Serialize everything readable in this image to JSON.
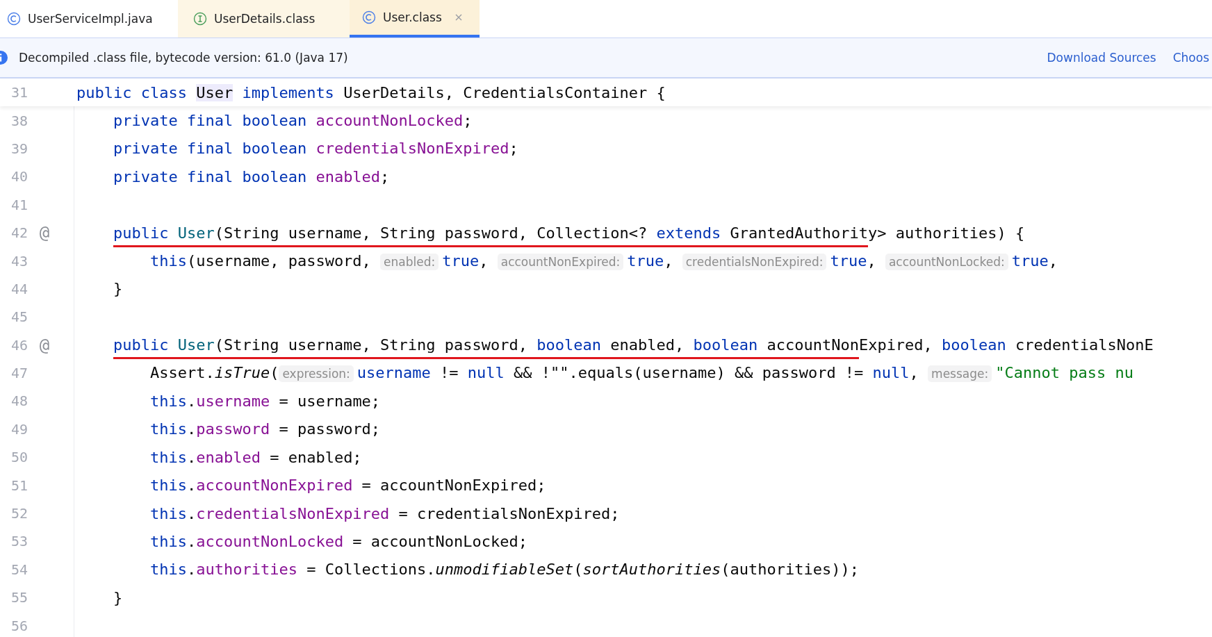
{
  "tabs": [
    {
      "label": "UserServiceImpl.java",
      "kind": "class",
      "selected": false,
      "closable": false,
      "tint": false
    },
    {
      "label": "UserDetails.class",
      "kind": "interface",
      "selected": false,
      "closable": false,
      "tint": true
    },
    {
      "label": "User.class",
      "kind": "class",
      "selected": true,
      "closable": true,
      "tint": true
    }
  ],
  "banner": {
    "text": "Decompiled .class file, bytecode version: 61.0 (Java 17)",
    "links": [
      "Download Sources",
      "Choos"
    ]
  },
  "lines": [
    {
      "number": "31",
      "kind": "header",
      "segments": [
        {
          "underline": false,
          "tokens": [
            {
              "kind": "kw",
              "text": "public class "
            },
            {
              "kind": "highlight",
              "text": "User"
            },
            {
              "kind": "kw",
              "text": " implements "
            },
            {
              "kind": "plain",
              "text": "UserDetails, CredentialsContainer {"
            }
          ]
        }
      ]
    },
    {
      "number": "38",
      "kind": "member",
      "segments": [
        {
          "underline": false,
          "tokens": [
            {
              "kind": "kw",
              "text": "private final boolean "
            },
            {
              "kind": "field",
              "text": "accountNonLocked"
            },
            {
              "kind": "plain",
              "text": ";"
            }
          ]
        }
      ]
    },
    {
      "number": "39",
      "kind": "member",
      "segments": [
        {
          "underline": false,
          "tokens": [
            {
              "kind": "kw",
              "text": "private final boolean "
            },
            {
              "kind": "field",
              "text": "credentialsNonExpired"
            },
            {
              "kind": "plain",
              "text": ";"
            }
          ]
        }
      ]
    },
    {
      "number": "40",
      "kind": "member",
      "segments": [
        {
          "underline": false,
          "tokens": [
            {
              "kind": "kw",
              "text": "private final boolean "
            },
            {
              "kind": "field",
              "text": "enabled"
            },
            {
              "kind": "plain",
              "text": ";"
            }
          ]
        }
      ]
    },
    {
      "number": "41",
      "kind": "member"
    },
    {
      "number": "42",
      "kind": "member",
      "gutter_mark": "@",
      "segments": [
        {
          "underline": true,
          "tokens": [
            {
              "kind": "kw",
              "text": "public "
            },
            {
              "kind": "ctor",
              "text": "User"
            },
            {
              "kind": "plain",
              "text": "(String username, String password, Collection<? "
            },
            {
              "kind": "kw",
              "text": "extends "
            },
            {
              "kind": "plain",
              "text": "GrantedAuthorit"
            }
          ]
        },
        {
          "underline": false,
          "tokens": [
            {
              "kind": "plain",
              "text": "y> authorities) {"
            }
          ]
        }
      ]
    },
    {
      "number": "43",
      "kind": "body",
      "segments": [
        {
          "underline": false,
          "tokens": [
            {
              "kind": "kw",
              "text": "this"
            },
            {
              "kind": "plain",
              "text": "(username, password, "
            },
            {
              "kind": "hint",
              "text": "enabled:"
            },
            {
              "kind": "kw",
              "text": "true"
            },
            {
              "kind": "plain",
              "text": ", "
            },
            {
              "kind": "hint",
              "text": "accountNonExpired:"
            },
            {
              "kind": "kw",
              "text": "true"
            },
            {
              "kind": "plain",
              "text": ", "
            },
            {
              "kind": "hint",
              "text": "credentialsNonExpired:"
            },
            {
              "kind": "kw",
              "text": "true"
            },
            {
              "kind": "plain",
              "text": ", "
            },
            {
              "kind": "hint",
              "text": "accountNonLocked:"
            },
            {
              "kind": "kw",
              "text": "true"
            },
            {
              "kind": "plain",
              "text": ","
            }
          ]
        }
      ]
    },
    {
      "number": "44",
      "kind": "member",
      "segments": [
        {
          "underline": false,
          "tokens": [
            {
              "kind": "plain",
              "text": "}"
            }
          ]
        }
      ]
    },
    {
      "number": "45",
      "kind": "member"
    },
    {
      "number": "46",
      "kind": "member",
      "gutter_mark": "@",
      "segments": [
        {
          "underline": true,
          "tokens": [
            {
              "kind": "kw",
              "text": "public "
            },
            {
              "kind": "ctor",
              "text": "User"
            },
            {
              "kind": "plain",
              "text": "(String username, String password, "
            },
            {
              "kind": "kw",
              "text": "boolean "
            },
            {
              "kind": "plain",
              "text": "enabled, "
            },
            {
              "kind": "kw",
              "text": "boolean "
            },
            {
              "kind": "plain",
              "text": "accountNon"
            }
          ]
        },
        {
          "underline": false,
          "tokens": [
            {
              "kind": "plain",
              "text": "Expired, "
            },
            {
              "kind": "kw",
              "text": "boolean "
            },
            {
              "kind": "plain",
              "text": "credentialsNonE"
            }
          ]
        }
      ]
    },
    {
      "number": "47",
      "kind": "body",
      "segments": [
        {
          "underline": false,
          "tokens": [
            {
              "kind": "plain",
              "text": "Assert."
            },
            {
              "kind": "italic",
              "text": "isTrue"
            },
            {
              "kind": "plain",
              "text": "("
            },
            {
              "kind": "hint",
              "text": "expression:"
            },
            {
              "kind": "kw",
              "text": "username"
            },
            {
              "kind": "plain",
              "text": " != "
            },
            {
              "kind": "kw",
              "text": "null"
            },
            {
              "kind": "plain",
              "text": " && !\"\".equals(username) && password != "
            },
            {
              "kind": "kw",
              "text": "null"
            },
            {
              "kind": "plain",
              "text": ", "
            },
            {
              "kind": "hint",
              "text": "message:"
            },
            {
              "kind": "str",
              "text": "\"Cannot pass nu"
            }
          ]
        }
      ]
    },
    {
      "number": "48",
      "kind": "body",
      "segments": [
        {
          "underline": false,
          "tokens": [
            {
              "kind": "kw",
              "text": "this"
            },
            {
              "kind": "plain",
              "text": "."
            },
            {
              "kind": "field",
              "text": "username"
            },
            {
              "kind": "plain",
              "text": " = username;"
            }
          ]
        }
      ]
    },
    {
      "number": "49",
      "kind": "body",
      "segments": [
        {
          "underline": false,
          "tokens": [
            {
              "kind": "kw",
              "text": "this"
            },
            {
              "kind": "plain",
              "text": "."
            },
            {
              "kind": "field",
              "text": "password"
            },
            {
              "kind": "plain",
              "text": " = password;"
            }
          ]
        }
      ]
    },
    {
      "number": "50",
      "kind": "body",
      "segments": [
        {
          "underline": false,
          "tokens": [
            {
              "kind": "kw",
              "text": "this"
            },
            {
              "kind": "plain",
              "text": "."
            },
            {
              "kind": "field",
              "text": "enabled"
            },
            {
              "kind": "plain",
              "text": " = enabled;"
            }
          ]
        }
      ]
    },
    {
      "number": "51",
      "kind": "body",
      "segments": [
        {
          "underline": false,
          "tokens": [
            {
              "kind": "kw",
              "text": "this"
            },
            {
              "kind": "plain",
              "text": "."
            },
            {
              "kind": "field",
              "text": "accountNonExpired"
            },
            {
              "kind": "plain",
              "text": " = accountNonExpired;"
            }
          ]
        }
      ]
    },
    {
      "number": "52",
      "kind": "body",
      "segments": [
        {
          "underline": false,
          "tokens": [
            {
              "kind": "kw",
              "text": "this"
            },
            {
              "kind": "plain",
              "text": "."
            },
            {
              "kind": "field",
              "text": "credentialsNonExpired"
            },
            {
              "kind": "plain",
              "text": " = credentialsNonExpired;"
            }
          ]
        }
      ]
    },
    {
      "number": "53",
      "kind": "body",
      "segments": [
        {
          "underline": false,
          "tokens": [
            {
              "kind": "kw",
              "text": "this"
            },
            {
              "kind": "plain",
              "text": "."
            },
            {
              "kind": "field",
              "text": "accountNonLocked"
            },
            {
              "kind": "plain",
              "text": " = accountNonLocked;"
            }
          ]
        }
      ]
    },
    {
      "number": "54",
      "kind": "body",
      "segments": [
        {
          "underline": false,
          "tokens": [
            {
              "kind": "kw",
              "text": "this"
            },
            {
              "kind": "plain",
              "text": "."
            },
            {
              "kind": "field",
              "text": "authorities"
            },
            {
              "kind": "plain",
              "text": " = Collections."
            },
            {
              "kind": "italic",
              "text": "unmodifiableSet"
            },
            {
              "kind": "plain",
              "text": "("
            },
            {
              "kind": "italic",
              "text": "sortAuthorities"
            },
            {
              "kind": "plain",
              "text": "(authorities));"
            }
          ]
        }
      ]
    },
    {
      "number": "55",
      "kind": "member",
      "segments": [
        {
          "underline": false,
          "tokens": [
            {
              "kind": "plain",
              "text": "}"
            }
          ]
        }
      ]
    },
    {
      "number": "56",
      "kind": "member"
    }
  ]
}
